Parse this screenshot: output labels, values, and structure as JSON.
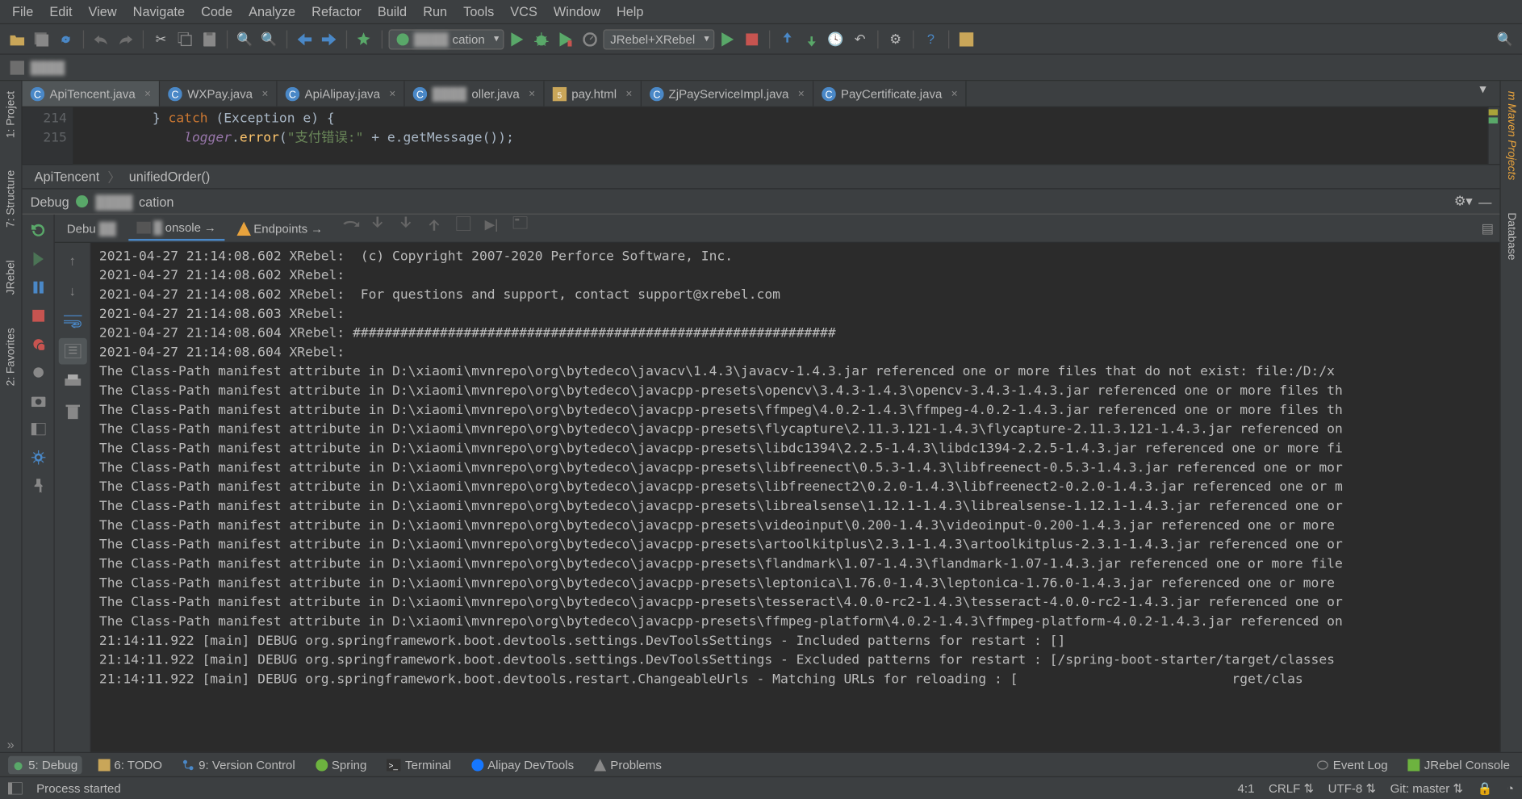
{
  "menubar": [
    "File",
    "Edit",
    "View",
    "Navigate",
    "Code",
    "Analyze",
    "Refactor",
    "Build",
    "Run",
    "Tools",
    "VCS",
    "Window",
    "Help"
  ],
  "toolbar": {
    "run_config": "cation",
    "jrebel": "JRebel+XRebel"
  },
  "navbar": {
    "project": ""
  },
  "tabs": [
    {
      "label": "ApiTencent.java",
      "icon": "class",
      "active": true
    },
    {
      "label": "WXPay.java",
      "icon": "class"
    },
    {
      "label": "ApiAlipay.java",
      "icon": "class"
    },
    {
      "label": "oller.java",
      "icon": "class",
      "blurred": true
    },
    {
      "label": "pay.html",
      "icon": "html"
    },
    {
      "label": "ZjPayServiceImpl.java",
      "icon": "class"
    },
    {
      "label": "PayCertificate.java",
      "icon": "class"
    }
  ],
  "gutter": [
    "214",
    "215"
  ],
  "code": {
    "l1_pre": "        } ",
    "l1_kw": "catch",
    "l1_post": " (Exception e) {",
    "l2_pre": "            ",
    "l2_id": "logger",
    "l2_dot": ".",
    "l2_call": "error",
    "l2_open": "(",
    "l2_str": "\"支付错误:\"",
    "l2_plus": " + e.getMessage());"
  },
  "crumb": {
    "class": "ApiTencent",
    "method": "unifiedOrder()"
  },
  "debug": {
    "title": "Debug",
    "config": "cation",
    "tabs": {
      "debugger": "Debu",
      "console": "onsole",
      "endpoints": "Endpoints"
    }
  },
  "console_lines": [
    "2021-04-27 21:14:08.602 XRebel:  (c) Copyright 2007-2020 Perforce Software, Inc.",
    "2021-04-27 21:14:08.602 XRebel:",
    "2021-04-27 21:14:08.602 XRebel:  For questions and support, contact support@xrebel.com",
    "2021-04-27 21:14:08.603 XRebel:",
    "2021-04-27 21:14:08.604 XRebel: #############################################################",
    "2021-04-27 21:14:08.604 XRebel:",
    "The Class-Path manifest attribute in D:\\xiaomi\\mvnrepo\\org\\bytedeco\\javacv\\1.4.3\\javacv-1.4.3.jar referenced one or more files that do not exist: file:/D:/x",
    "The Class-Path manifest attribute in D:\\xiaomi\\mvnrepo\\org\\bytedeco\\javacpp-presets\\opencv\\3.4.3-1.4.3\\opencv-3.4.3-1.4.3.jar referenced one or more files th",
    "The Class-Path manifest attribute in D:\\xiaomi\\mvnrepo\\org\\bytedeco\\javacpp-presets\\ffmpeg\\4.0.2-1.4.3\\ffmpeg-4.0.2-1.4.3.jar referenced one or more files th",
    "The Class-Path manifest attribute in D:\\xiaomi\\mvnrepo\\org\\bytedeco\\javacpp-presets\\flycapture\\2.11.3.121-1.4.3\\flycapture-2.11.3.121-1.4.3.jar referenced on",
    "The Class-Path manifest attribute in D:\\xiaomi\\mvnrepo\\org\\bytedeco\\javacpp-presets\\libdc1394\\2.2.5-1.4.3\\libdc1394-2.2.5-1.4.3.jar referenced one or more fi",
    "The Class-Path manifest attribute in D:\\xiaomi\\mvnrepo\\org\\bytedeco\\javacpp-presets\\libfreenect\\0.5.3-1.4.3\\libfreenect-0.5.3-1.4.3.jar referenced one or mor",
    "The Class-Path manifest attribute in D:\\xiaomi\\mvnrepo\\org\\bytedeco\\javacpp-presets\\libfreenect2\\0.2.0-1.4.3\\libfreenect2-0.2.0-1.4.3.jar referenced one or m",
    "The Class-Path manifest attribute in D:\\xiaomi\\mvnrepo\\org\\bytedeco\\javacpp-presets\\librealsense\\1.12.1-1.4.3\\librealsense-1.12.1-1.4.3.jar referenced one or",
    "The Class-Path manifest attribute in D:\\xiaomi\\mvnrepo\\org\\bytedeco\\javacpp-presets\\videoinput\\0.200-1.4.3\\videoinput-0.200-1.4.3.jar referenced one or more ",
    "The Class-Path manifest attribute in D:\\xiaomi\\mvnrepo\\org\\bytedeco\\javacpp-presets\\artoolkitplus\\2.3.1-1.4.3\\artoolkitplus-2.3.1-1.4.3.jar referenced one or",
    "The Class-Path manifest attribute in D:\\xiaomi\\mvnrepo\\org\\bytedeco\\javacpp-presets\\flandmark\\1.07-1.4.3\\flandmark-1.07-1.4.3.jar referenced one or more file",
    "The Class-Path manifest attribute in D:\\xiaomi\\mvnrepo\\org\\bytedeco\\javacpp-presets\\leptonica\\1.76.0-1.4.3\\leptonica-1.76.0-1.4.3.jar referenced one or more ",
    "The Class-Path manifest attribute in D:\\xiaomi\\mvnrepo\\org\\bytedeco\\javacpp-presets\\tesseract\\4.0.0-rc2-1.4.3\\tesseract-4.0.0-rc2-1.4.3.jar referenced one or",
    "The Class-Path manifest attribute in D:\\xiaomi\\mvnrepo\\org\\bytedeco\\javacpp-presets\\ffmpeg-platform\\4.0.2-1.4.3\\ffmpeg-platform-4.0.2-1.4.3.jar referenced on",
    "21:14:11.922 [main] DEBUG org.springframework.boot.devtools.settings.DevToolsSettings - Included patterns for restart : []",
    "21:14:11.922 [main] DEBUG org.springframework.boot.devtools.settings.DevToolsSettings - Excluded patterns for restart : [/spring-boot-starter/target/classes",
    "21:14:11.922 [main] DEBUG org.springframework.boot.devtools.restart.ChangeableUrls - Matching URLs for reloading : [                           rget/clas"
  ],
  "left_tools": [
    "1: Project",
    "7: Structure",
    "JRebel",
    "2: Favorites"
  ],
  "right_tools": [
    "Maven Projects",
    "Database"
  ],
  "bottom_tools": {
    "debug": "5: Debug",
    "todo": "6: TODO",
    "vcs": "9: Version Control",
    "spring": "Spring",
    "terminal": "Terminal",
    "alipay": "Alipay DevTools",
    "problems": "Problems",
    "eventlog": "Event Log",
    "jrebel": "JRebel Console"
  },
  "status": {
    "msg": "Process started",
    "pos": "4:1",
    "eol": "CRLF",
    "enc": "UTF-8",
    "git": "Git: master"
  }
}
